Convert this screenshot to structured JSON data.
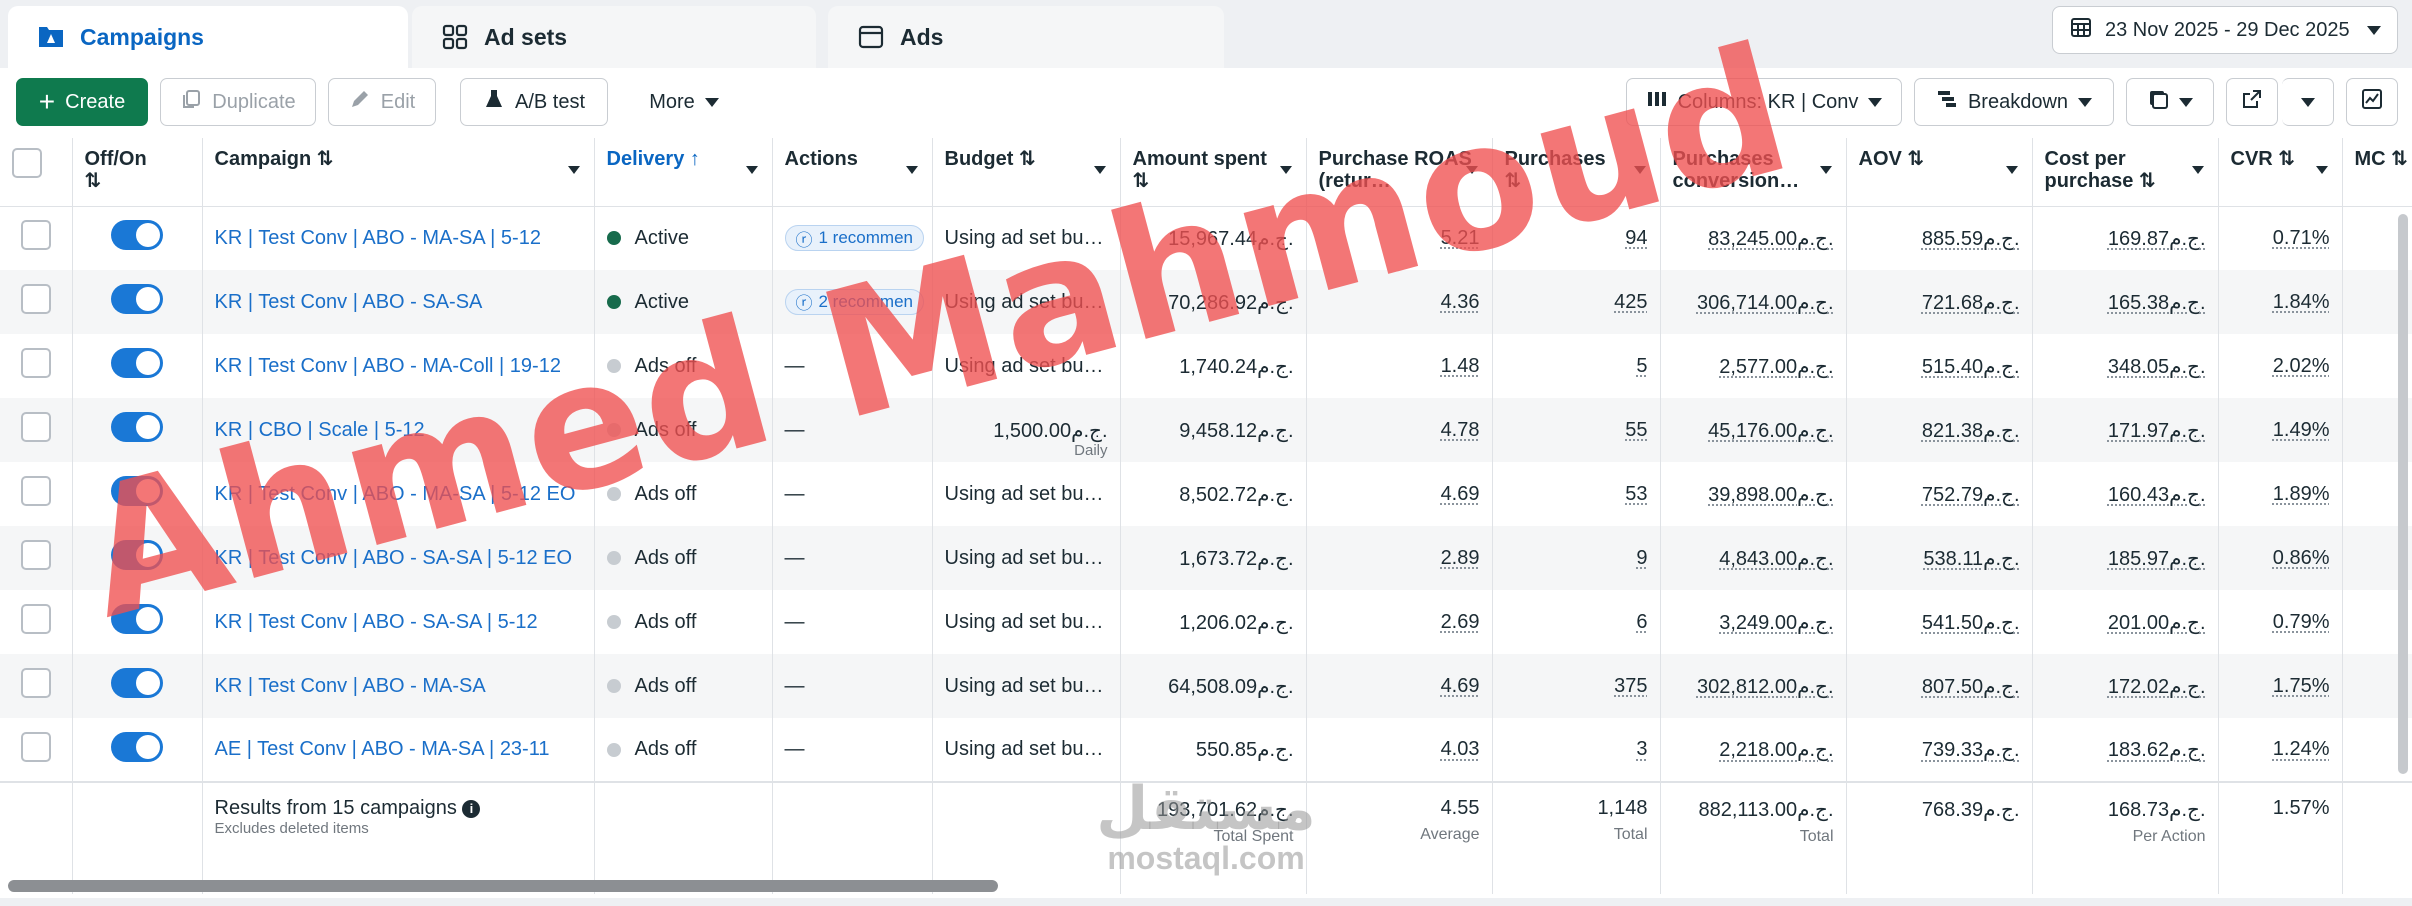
{
  "tabs": [
    {
      "label": "Campaigns",
      "icon": "campaign-icon"
    },
    {
      "label": "Ad sets",
      "icon": "grid-icon"
    },
    {
      "label": "Ads",
      "icon": "window-icon"
    }
  ],
  "date_range": "23 Nov 2025 - 29 Dec 2025",
  "toolbar": {
    "create": "Create",
    "duplicate": "Duplicate",
    "edit": "Edit",
    "ab_test": "A/B test",
    "more": "More",
    "columns": "Columns: KR | Conv",
    "breakdown": "Breakdown"
  },
  "columns": {
    "offon": "Off/On",
    "campaign": "Campaign",
    "delivery": "Delivery",
    "actions": "Actions",
    "budget": "Budget",
    "amount_spent": "Amount spent",
    "roas": "Purchase ROAS (retur…",
    "purchases": "Purchases",
    "conv": "Purchases conversion…",
    "aov": "AOV",
    "cpp": "Cost per purchase",
    "cvr": "CVR",
    "mc": "MC"
  },
  "rows": [
    {
      "campaign": "KR | Test Conv | ABO - MA-SA | 5-12",
      "delivery": "Active",
      "status": "active",
      "action": "1 recommen",
      "budget": "Using ad set bu…",
      "daily": "",
      "spent": "15,967.44ج.م.",
      "roas": "5.21",
      "purchases": "94",
      "conv": "83,245.00ج.م.",
      "aov": "885.59ج.م.",
      "cpp": "169.87ج.م.",
      "cvr": "0.71%",
      "mc": ""
    },
    {
      "campaign": "KR | Test Conv | ABO - SA-SA",
      "delivery": "Active",
      "status": "active",
      "action": "2 recommen",
      "budget": "Using ad set bu…",
      "daily": "",
      "spent": "70,286.92ج.م.",
      "roas": "4.36",
      "purchases": "425",
      "conv": "306,714.00ج.م.",
      "aov": "721.68ج.م.",
      "cpp": "165.38ج.م.",
      "cvr": "1.84%",
      "mc": ""
    },
    {
      "campaign": "KR | Test Conv | ABO - MA-Coll | 19-12",
      "delivery": "Ads off",
      "status": "off",
      "action": "—",
      "budget": "Using ad set bu…",
      "daily": "",
      "spent": "1,740.24ج.م.",
      "roas": "1.48",
      "purchases": "5",
      "conv": "2,577.00ج.م.",
      "aov": "515.40ج.م.",
      "cpp": "348.05ج.م.",
      "cvr": "2.02%",
      "mc": ""
    },
    {
      "campaign": "KR | CBO | Scale | 5-12",
      "delivery": "Ads off",
      "status": "off",
      "action": "—",
      "budget": "1,500.00ج.م.",
      "daily": "Daily",
      "spent": "9,458.12ج.م.",
      "roas": "4.78",
      "purchases": "55",
      "conv": "45,176.00ج.م.",
      "aov": "821.38ج.م.",
      "cpp": "171.97ج.م.",
      "cvr": "1.49%",
      "mc": ""
    },
    {
      "campaign": "KR | Test Conv | ABO - MA-SA | 5-12 EO",
      "delivery": "Ads off",
      "status": "off",
      "action": "—",
      "budget": "Using ad set bu…",
      "daily": "",
      "spent": "8,502.72ج.م.",
      "roas": "4.69",
      "purchases": "53",
      "conv": "39,898.00ج.م.",
      "aov": "752.79ج.م.",
      "cpp": "160.43ج.م.",
      "cvr": "1.89%",
      "mc": ""
    },
    {
      "campaign": "KR | Test Conv | ABO - SA-SA | 5-12 EO",
      "delivery": "Ads off",
      "status": "off",
      "action": "—",
      "budget": "Using ad set bu…",
      "daily": "",
      "spent": "1,673.72ج.م.",
      "roas": "2.89",
      "purchases": "9",
      "conv": "4,843.00ج.م.",
      "aov": "538.11ج.م.",
      "cpp": "185.97ج.م.",
      "cvr": "0.86%",
      "mc": ""
    },
    {
      "campaign": "KR | Test Conv | ABO - SA-SA | 5-12",
      "delivery": "Ads off",
      "status": "off",
      "action": "—",
      "budget": "Using ad set bu…",
      "daily": "",
      "spent": "1,206.02ج.م.",
      "roas": "2.69",
      "purchases": "6",
      "conv": "3,249.00ج.م.",
      "aov": "541.50ج.م.",
      "cpp": "201.00ج.م.",
      "cvr": "0.79%",
      "mc": ""
    },
    {
      "campaign": "KR | Test Conv | ABO - MA-SA",
      "delivery": "Ads off",
      "status": "off",
      "action": "—",
      "budget": "Using ad set bu…",
      "daily": "",
      "spent": "64,508.09ج.م.",
      "roas": "4.69",
      "purchases": "375",
      "conv": "302,812.00ج.م.",
      "aov": "807.50ج.م.",
      "cpp": "172.02ج.م.",
      "cvr": "1.75%",
      "mc": ""
    },
    {
      "campaign": "AE | Test Conv | ABO - MA-SA | 23-11",
      "delivery": "Ads off",
      "status": "off",
      "action": "—",
      "budget": "Using ad set bu…",
      "daily": "",
      "spent": "550.85ج.م.",
      "roas": "4.03",
      "purchases": "3",
      "conv": "2,218.00ج.م.",
      "aov": "739.33ج.م.",
      "cpp": "183.62ج.م.",
      "cvr": "1.24%",
      "mc": ""
    }
  ],
  "summary": {
    "title": "Results from 15 campaigns",
    "sub": "Excludes deleted items",
    "spent": "193,701.62ج.م.",
    "spent_label": "Total Spent",
    "roas": "4.55",
    "roas_label": "Average",
    "purchases": "1,148",
    "purchases_label": "Total",
    "conv": "882,113.00ج.م.",
    "conv_label": "Total",
    "aov": "768.39ج.م.",
    "cpp": "168.73ج.م.",
    "cpp_label": "Per Action",
    "cvr": "1.57%"
  },
  "watermark": {
    "text": "Ahmed Mahmoud",
    "site_ar": "مستقل",
    "site": "mostaql.com"
  }
}
